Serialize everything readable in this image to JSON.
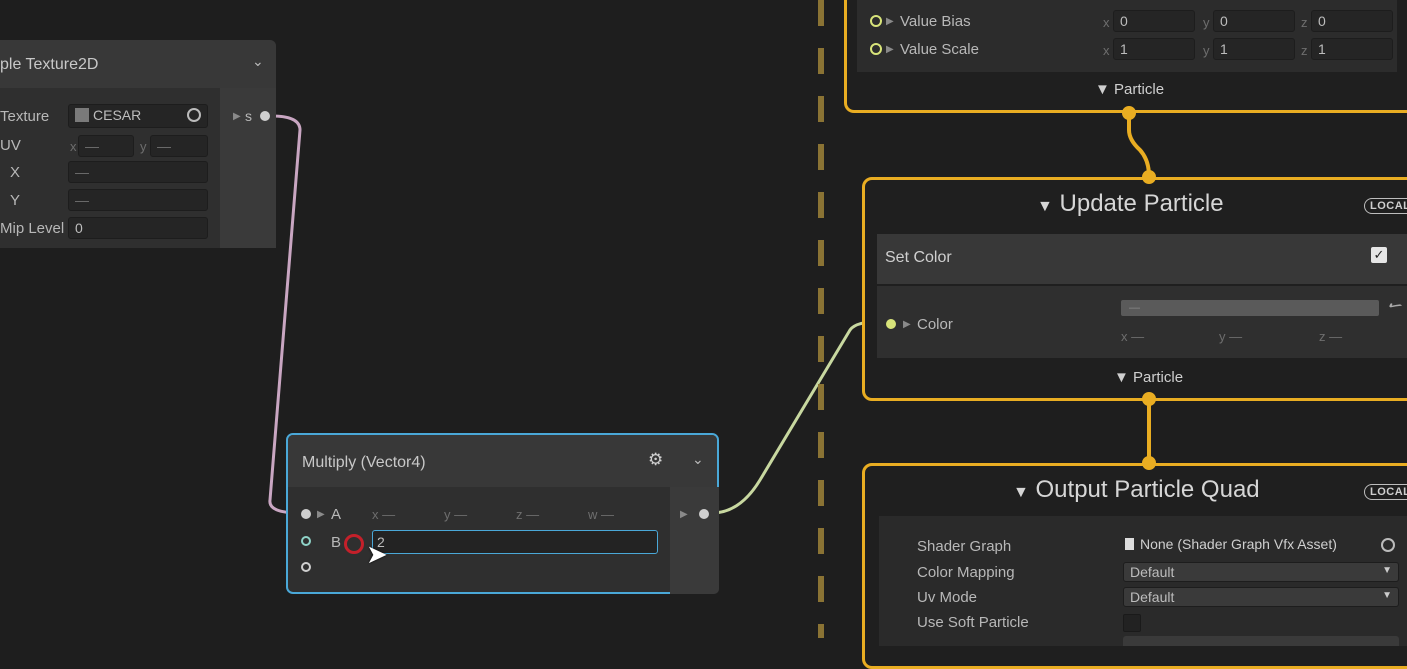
{
  "sample_node": {
    "title": "ple Texture2D",
    "texture_label": "Texture",
    "texture_value": "CESAR",
    "uv_label": "UV",
    "uv_x": "x",
    "uv_y": "y",
    "dash": "—",
    "x_label": "X",
    "y_label": "Y",
    "mip_label": "Mip Level",
    "mip_value": "0",
    "out_label": "s"
  },
  "top_context": {
    "value_bias_label": "Value Bias",
    "value_scale_label": "Value Scale",
    "bias": {
      "x": "0",
      "y": "0",
      "z": "0"
    },
    "scale": {
      "x": "1",
      "y": "1",
      "z": "1"
    },
    "axis_x": "x",
    "axis_y": "y",
    "axis_z": "z",
    "footer": "Particle"
  },
  "update_context": {
    "title": "Update Particle",
    "badge": "LOCAL",
    "block_title": "Set Color",
    "color_label": "Color",
    "dash": "—",
    "axis_x": "x",
    "axis_y": "y",
    "axis_z": "z",
    "footer": "Particle"
  },
  "output_context": {
    "title": "Output Particle Quad",
    "badge": "LOCAL",
    "shader_graph_label": "Shader Graph",
    "shader_graph_value": "None (Shader Graph Vfx Asset)",
    "color_mapping_label": "Color Mapping",
    "color_mapping_value": "Default",
    "uv_mode_label": "Uv Mode",
    "uv_mode_value": "Default",
    "soft_particle_label": "Use Soft Particle"
  },
  "multiply_node": {
    "title": "Multiply (Vector4)",
    "a_label": "A",
    "b_label": "B",
    "axis_x": "x",
    "axis_y": "y",
    "axis_z": "z",
    "axis_w": "w",
    "dash": "—",
    "b_input_value": "2"
  },
  "colors": {
    "context_border": "#e9ad22",
    "selection_border": "#4aa8d8",
    "edge_pink": "#c9a6c2",
    "edge_green": "#c8d8a0"
  }
}
